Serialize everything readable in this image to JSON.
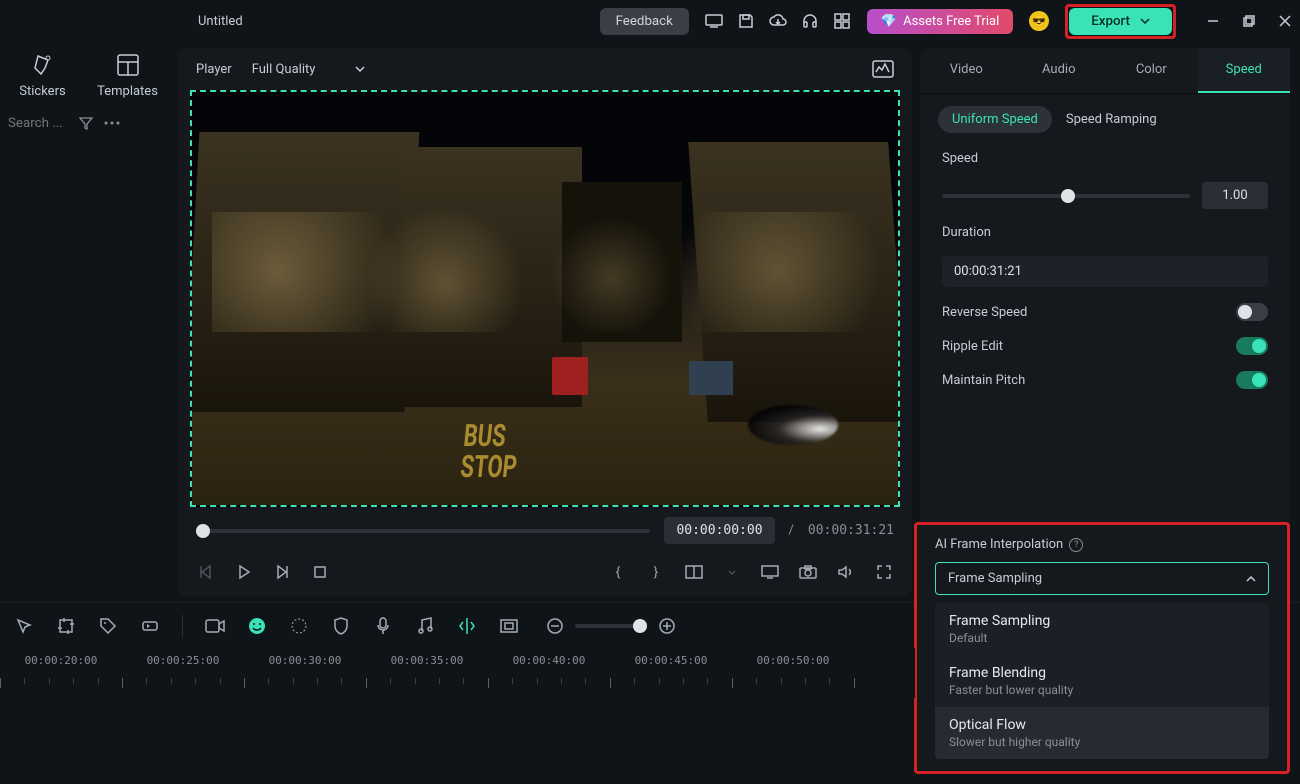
{
  "title": "Untitled",
  "header": {
    "feedback": "Feedback",
    "assets_trial": "Assets Free Trial",
    "export": "Export"
  },
  "leftbar": {
    "tabs": {
      "stickers": "Stickers",
      "templates": "Templates"
    },
    "search_placeholder": "Search ..."
  },
  "player": {
    "label": "Player",
    "quality": "Full Quality",
    "time_current": "00:00:00:00",
    "time_sep": "/",
    "time_total": "00:00:31:21",
    "preview_text_1": "BUS",
    "preview_text_2": "STOP"
  },
  "panel": {
    "tabs": {
      "video": "Video",
      "audio": "Audio",
      "color": "Color",
      "speed": "Speed"
    },
    "subtabs": {
      "uniform": "Uniform Speed",
      "ramping": "Speed Ramping"
    },
    "speed_label": "Speed",
    "speed_value": "1.00",
    "duration_label": "Duration",
    "duration_value": "00:00:31:21",
    "reverse_label": "Reverse Speed",
    "ripple_label": "Ripple Edit",
    "pitch_label": "Maintain Pitch",
    "ai_label": "AI Frame Interpolation",
    "dropdown_selected": "Frame Sampling",
    "options": [
      {
        "title": "Frame Sampling",
        "sub": "Default"
      },
      {
        "title": "Frame Blending",
        "sub": "Faster but lower quality"
      },
      {
        "title": "Optical Flow",
        "sub": "Slower but higher quality"
      }
    ]
  },
  "timeline": {
    "labels": [
      "00:00:20:00",
      "00:00:25:00",
      "00:00:30:00",
      "00:00:35:00",
      "00:00:40:00",
      "00:00:45:00",
      "00:00:50:00"
    ]
  }
}
